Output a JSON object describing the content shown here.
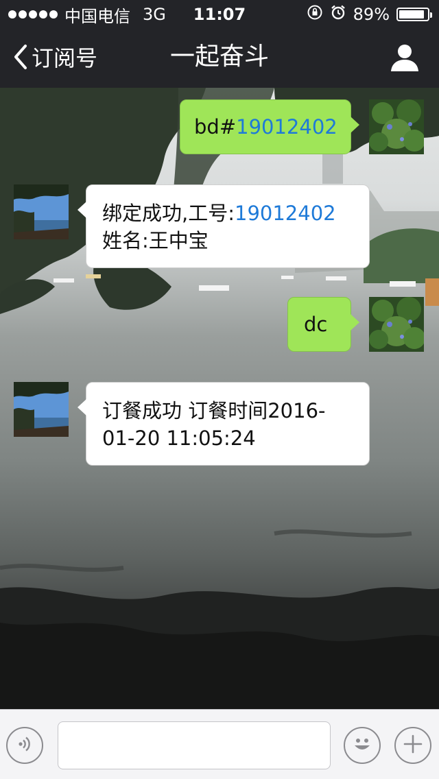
{
  "status_bar": {
    "carrier": "中国电信",
    "network": "3G",
    "time": "11:07",
    "battery": "89%",
    "battery_level": 0.89
  },
  "nav": {
    "back_label": "订阅号",
    "title": "一起奋斗"
  },
  "messages": [
    {
      "direction": "out",
      "parts": [
        {
          "text": "bd#",
          "link": false
        },
        {
          "text": "19012402",
          "link": true
        }
      ]
    },
    {
      "direction": "in",
      "lines": [
        [
          {
            "text": "绑定成功,工号:",
            "link": false
          },
          {
            "text": "19012402",
            "link": true
          }
        ],
        [
          {
            "text": "姓名:王中宝",
            "link": false
          }
        ]
      ]
    },
    {
      "direction": "out",
      "parts": [
        {
          "text": "dc",
          "link": false
        }
      ]
    },
    {
      "direction": "in",
      "lines": [
        [
          {
            "text": "订餐成功 订餐时间2016-",
            "link": false
          }
        ],
        [
          {
            "text": "01-20 11:05:24",
            "link": false
          }
        ]
      ]
    }
  ],
  "input": {
    "value": "",
    "placeholder": ""
  },
  "colors": {
    "outgoing_bubble": "#9fe558",
    "incoming_bubble": "#ffffff",
    "link": "#1e7ad8",
    "header": "#232428"
  },
  "icons": [
    "signal-dots-icon",
    "orientation-lock-icon",
    "alarm-icon",
    "battery-icon",
    "back-chevron-icon",
    "profile-icon",
    "voice-icon",
    "emoji-icon",
    "plus-icon"
  ]
}
